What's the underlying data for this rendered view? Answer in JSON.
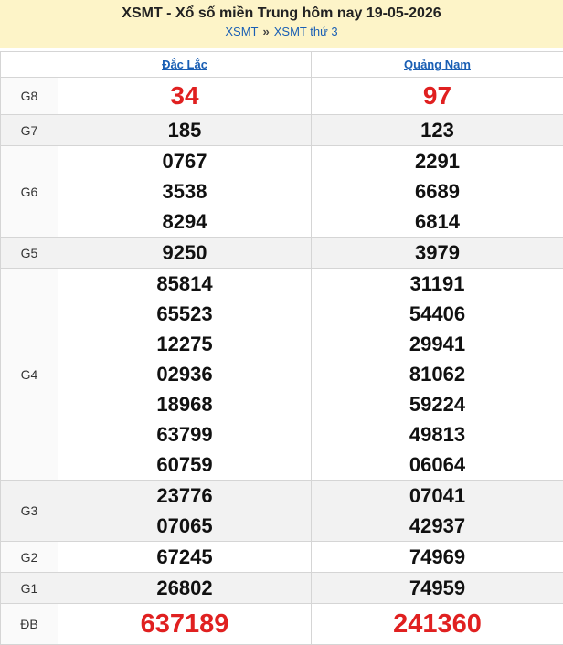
{
  "header": {
    "title": "XSMT - Xổ số miền Trung hôm nay 19-05-2026",
    "crumb_1": "XSMT",
    "separator": "»",
    "crumb_2": "XSMT thứ 3"
  },
  "provinces": [
    "Đắc Lắc",
    "Quảng Nam"
  ],
  "prizes": [
    {
      "label": "G8",
      "style": "big",
      "dac_lac": [
        "34"
      ],
      "quang_nam": [
        "97"
      ]
    },
    {
      "label": "G7",
      "style": "normal",
      "dac_lac": [
        "185"
      ],
      "quang_nam": [
        "123"
      ]
    },
    {
      "label": "G6",
      "style": "normal",
      "dac_lac": [
        "0767",
        "3538",
        "8294"
      ],
      "quang_nam": [
        "2291",
        "6689",
        "6814"
      ]
    },
    {
      "label": "G5",
      "style": "normal",
      "dac_lac": [
        "9250"
      ],
      "quang_nam": [
        "3979"
      ]
    },
    {
      "label": "G4",
      "style": "normal",
      "dac_lac": [
        "85814",
        "65523",
        "12275",
        "02936",
        "18968",
        "63799",
        "60759"
      ],
      "quang_nam": [
        "31191",
        "54406",
        "29941",
        "81062",
        "59224",
        "49813",
        "06064"
      ]
    },
    {
      "label": "G3",
      "style": "normal",
      "dac_lac": [
        "23776",
        "07065"
      ],
      "quang_nam": [
        "07041",
        "42937"
      ]
    },
    {
      "label": "G2",
      "style": "normal",
      "dac_lac": [
        "67245"
      ],
      "quang_nam": [
        "74969"
      ]
    },
    {
      "label": "G1",
      "style": "normal",
      "dac_lac": [
        "26802"
      ],
      "quang_nam": [
        "74959"
      ]
    },
    {
      "label": "ĐB",
      "style": "special",
      "dac_lac": [
        "637189"
      ],
      "quang_nam": [
        "241360"
      ]
    }
  ],
  "colors": {
    "header_bg": "#fdf4c8",
    "link": "#1a5fb4",
    "highlight_number": "#e02020"
  }
}
